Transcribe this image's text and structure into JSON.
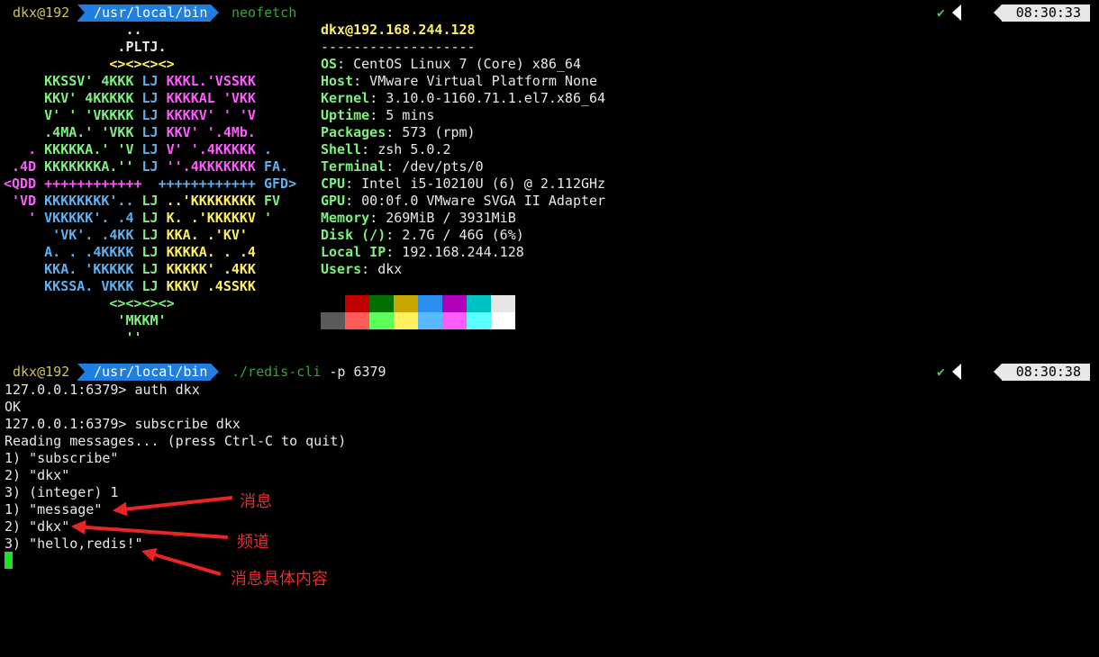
{
  "prompts": [
    {
      "user": "dkx@192",
      "path": "/usr/local/bin",
      "cmd_main": "neofetch",
      "cmd_args": "",
      "check": "✔",
      "time": "08:30:33"
    },
    {
      "user": "dkx@192",
      "path": "/usr/local/bin",
      "cmd_main": "./redis-cli",
      "cmd_args": " -p 6379",
      "check": "✔",
      "time": "08:30:38"
    }
  ],
  "art": [
    [
      {
        "t": "               ..",
        "c": "#e8e8e8"
      }
    ],
    [
      {
        "t": "              .PLTJ.",
        "c": "#e8e8e8"
      }
    ],
    [
      {
        "t": "             <><><><>",
        "c": "#fff060"
      }
    ],
    [
      {
        "t": "     KKSSV' 4KKK ",
        "c": "#7ff07f"
      },
      {
        "t": "LJ ",
        "c": "#5fb0f0"
      },
      {
        "t": "KKKL.'VSSKK",
        "c": "#ff5cff"
      }
    ],
    [
      {
        "t": "     KKV' 4KKKKK ",
        "c": "#7ff07f"
      },
      {
        "t": "LJ ",
        "c": "#5fb0f0"
      },
      {
        "t": "KKKKAL 'VKK",
        "c": "#ff5cff"
      }
    ],
    [
      {
        "t": "     V' ' 'VKKKK ",
        "c": "#7ff07f"
      },
      {
        "t": "LJ ",
        "c": "#5fb0f0"
      },
      {
        "t": "KKKKV' ' 'V",
        "c": "#ff5cff"
      }
    ],
    [
      {
        "t": "     .4MA.' 'VKK ",
        "c": "#7ff07f"
      },
      {
        "t": "LJ ",
        "c": "#5fb0f0"
      },
      {
        "t": "KKV' '.4Mb.",
        "c": "#ff5cff"
      }
    ],
    [
      {
        "t": "   . ",
        "c": "#ff5cff"
      },
      {
        "t": "KKKKKA.' 'V ",
        "c": "#7ff07f"
      },
      {
        "t": "LJ ",
        "c": "#5fb0f0"
      },
      {
        "t": "V' '.4KKKKK ",
        "c": "#ff5cff"
      },
      {
        "t": ".",
        "c": "#5fb0f0"
      }
    ],
    [
      {
        "t": " .4D ",
        "c": "#ff5cff"
      },
      {
        "t": "KKKKKKKA.'' ",
        "c": "#7ff07f"
      },
      {
        "t": "LJ ",
        "c": "#5fb0f0"
      },
      {
        "t": "''.4KKKKKKK ",
        "c": "#ff5cff"
      },
      {
        "t": "FA.",
        "c": "#5fb0f0"
      }
    ],
    [
      {
        "t": "<QDD ++++++++++++  ",
        "c": "#ff5cff"
      },
      {
        "t": "++++++++++++ GFD>",
        "c": "#5fb0f0"
      }
    ],
    [
      {
        "t": " 'VD ",
        "c": "#ff5cff"
      },
      {
        "t": "KKKKKKKK'.. ",
        "c": "#5fb0f0"
      },
      {
        "t": "LJ ",
        "c": "#7ff07f"
      },
      {
        "t": "..'KKKKKKKK ",
        "c": "#fff060"
      },
      {
        "t": "FV",
        "c": "#7ff07f"
      }
    ],
    [
      {
        "t": "   ' ",
        "c": "#ff5cff"
      },
      {
        "t": "VKKKKK'. .4 ",
        "c": "#5fb0f0"
      },
      {
        "t": "LJ ",
        "c": "#7ff07f"
      },
      {
        "t": "K. .'KKKKKV ",
        "c": "#fff060"
      },
      {
        "t": "'",
        "c": "#7ff07f"
      }
    ],
    [
      {
        "t": "      'VK'. .4KK ",
        "c": "#5fb0f0"
      },
      {
        "t": "LJ ",
        "c": "#7ff07f"
      },
      {
        "t": "KKA. .'KV'",
        "c": "#fff060"
      }
    ],
    [
      {
        "t": "     A. . .4KKKK ",
        "c": "#5fb0f0"
      },
      {
        "t": "LJ ",
        "c": "#7ff07f"
      },
      {
        "t": "KKKKA. . .4",
        "c": "#fff060"
      }
    ],
    [
      {
        "t": "     KKA. 'KKKKK ",
        "c": "#5fb0f0"
      },
      {
        "t": "LJ ",
        "c": "#7ff07f"
      },
      {
        "t": "KKKKK' .4KK",
        "c": "#fff060"
      }
    ],
    [
      {
        "t": "     KKSSA. VKKK ",
        "c": "#5fb0f0"
      },
      {
        "t": "LJ ",
        "c": "#7ff07f"
      },
      {
        "t": "KKKV .4SSKK",
        "c": "#fff060"
      }
    ],
    [
      {
        "t": "             <><><><>",
        "c": "#7ff07f"
      }
    ],
    [
      {
        "t": "              'MKKM'",
        "c": "#7ff07f"
      }
    ],
    [
      {
        "t": "               ''",
        "c": "#7ff07f"
      }
    ]
  ],
  "info": {
    "title": "dkx@192.168.244.128",
    "dashes": "-------------------",
    "rows": [
      {
        "k": "OS",
        "v": " CentOS Linux 7 (Core) x86_64"
      },
      {
        "k": "Host",
        "v": " VMware Virtual Platform None"
      },
      {
        "k": "Kernel",
        "v": " 3.10.0-1160.71.1.el7.x86_64"
      },
      {
        "k": "Uptime",
        "v": " 5 mins"
      },
      {
        "k": "Packages",
        "v": " 573 (rpm)"
      },
      {
        "k": "Shell",
        "v": " zsh 5.0.2"
      },
      {
        "k": "Terminal",
        "v": " /dev/pts/0"
      },
      {
        "k": "CPU",
        "v": " Intel i5-10210U (6) @ 2.112GHz"
      },
      {
        "k": "GPU",
        "v": " 00:0f.0 VMware SVGA II Adapter"
      },
      {
        "k": "Memory",
        "v": " 269MiB / 3931MiB"
      },
      {
        "k": "Disk (/)",
        "v": " 2.7G / 46G (6%)"
      },
      {
        "k": "Local IP",
        "v": " 192.168.244.128"
      },
      {
        "k": "Users",
        "v": " dkx"
      }
    ]
  },
  "palette": {
    "row1": [
      "#000000",
      "#c00000",
      "#007000",
      "#c8a800",
      "#2a8ff0",
      "#b000b8",
      "#00c0c0",
      "#e6e6e6"
    ],
    "row2": [
      "#5a5a5a",
      "#ff5a5a",
      "#5aff5a",
      "#fff060",
      "#5ab8ff",
      "#ff5cff",
      "#5affff",
      "#ffffff"
    ]
  },
  "output": [
    "127.0.0.1:6379> auth dkx",
    "OK",
    "127.0.0.1:6379> subscribe dkx",
    "Reading messages... (press Ctrl-C to quit)",
    "1) \"subscribe\"",
    "2) \"dkx\"",
    "3) (integer) 1",
    "1) \"message\"",
    "2) \"dkx\"",
    "3) \"hello,redis!\""
  ],
  "annotations": {
    "message": "消息",
    "channel": "频道",
    "content": "消息具体内容",
    "arrow_color": "#e82525"
  }
}
